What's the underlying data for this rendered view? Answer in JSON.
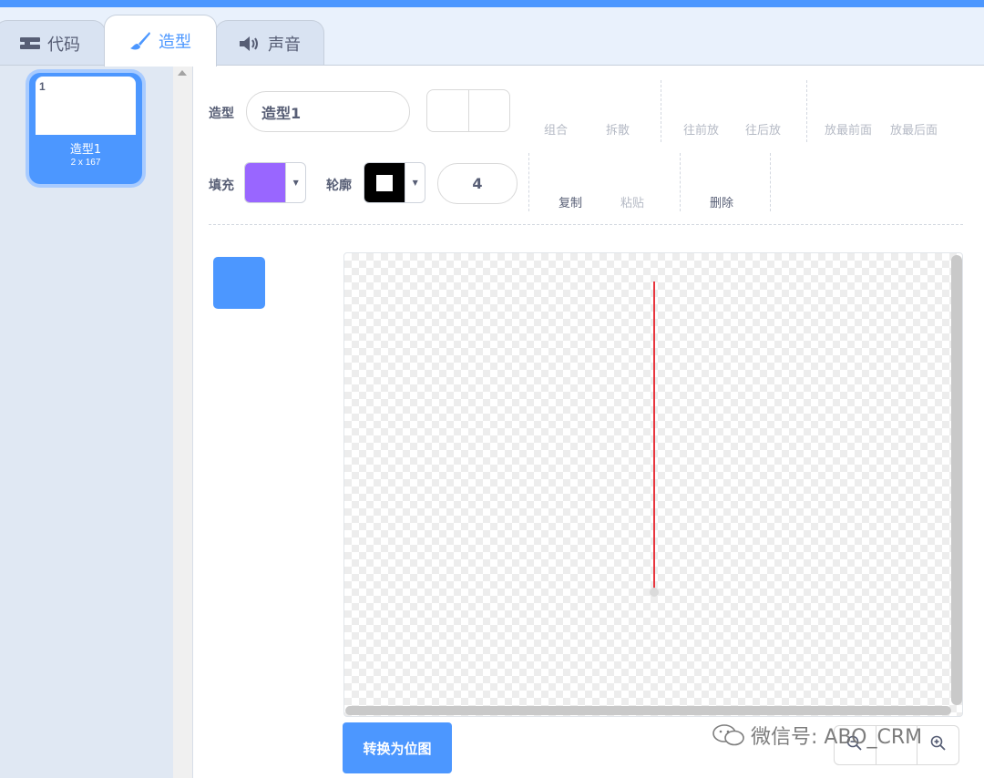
{
  "tabs": {
    "code": {
      "label": "代码",
      "icon": "code-blocks-icon"
    },
    "costumes": {
      "label": "造型",
      "icon": "paintbrush-icon"
    },
    "sounds": {
      "label": "声音",
      "icon": "speaker-icon"
    }
  },
  "costume_list": {
    "items": [
      {
        "index": "1",
        "name": "造型1",
        "size": "2 x 167"
      }
    ]
  },
  "editor": {
    "costume_label": "造型",
    "costume_name": "造型1",
    "fill_label": "填充",
    "outline_label": "轮廓",
    "stroke_width": "4",
    "actions": {
      "group": "组合",
      "ungroup": "拆散",
      "forward": "往前放",
      "backward": "往后放",
      "front": "放最前面",
      "back": "放最后面",
      "copy": "复制",
      "paste": "粘贴",
      "delete": "删除"
    },
    "convert_button": "转换为位图",
    "colors": {
      "fill": "#9966ff",
      "outline": "#000000",
      "accent": "#4c97ff",
      "line": "#e8363e"
    }
  },
  "watermark": "微信号: ABO_CRM"
}
